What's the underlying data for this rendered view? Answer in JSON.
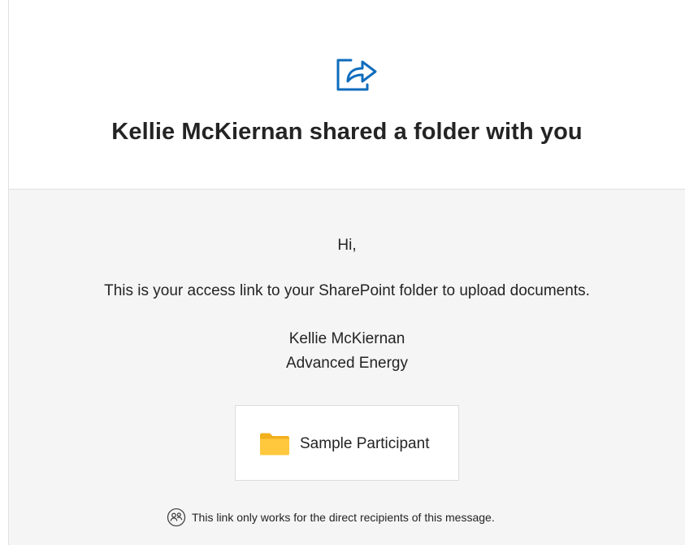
{
  "header": {
    "icon": "share-icon",
    "title": "Kellie McKiernan shared a folder with you",
    "accent_color": "#0f6cbd"
  },
  "message": {
    "greeting": "Hi,",
    "body": "This is your access link to your SharePoint folder to upload documents.",
    "sender_name": "Kellie McKiernan",
    "sender_org": "Advanced Energy"
  },
  "folder": {
    "icon": "folder-icon",
    "name": "Sample Participant",
    "icon_color": "#ffc83d"
  },
  "footer": {
    "icon": "people-icon",
    "note": "This link only works for the direct recipients of this message."
  }
}
